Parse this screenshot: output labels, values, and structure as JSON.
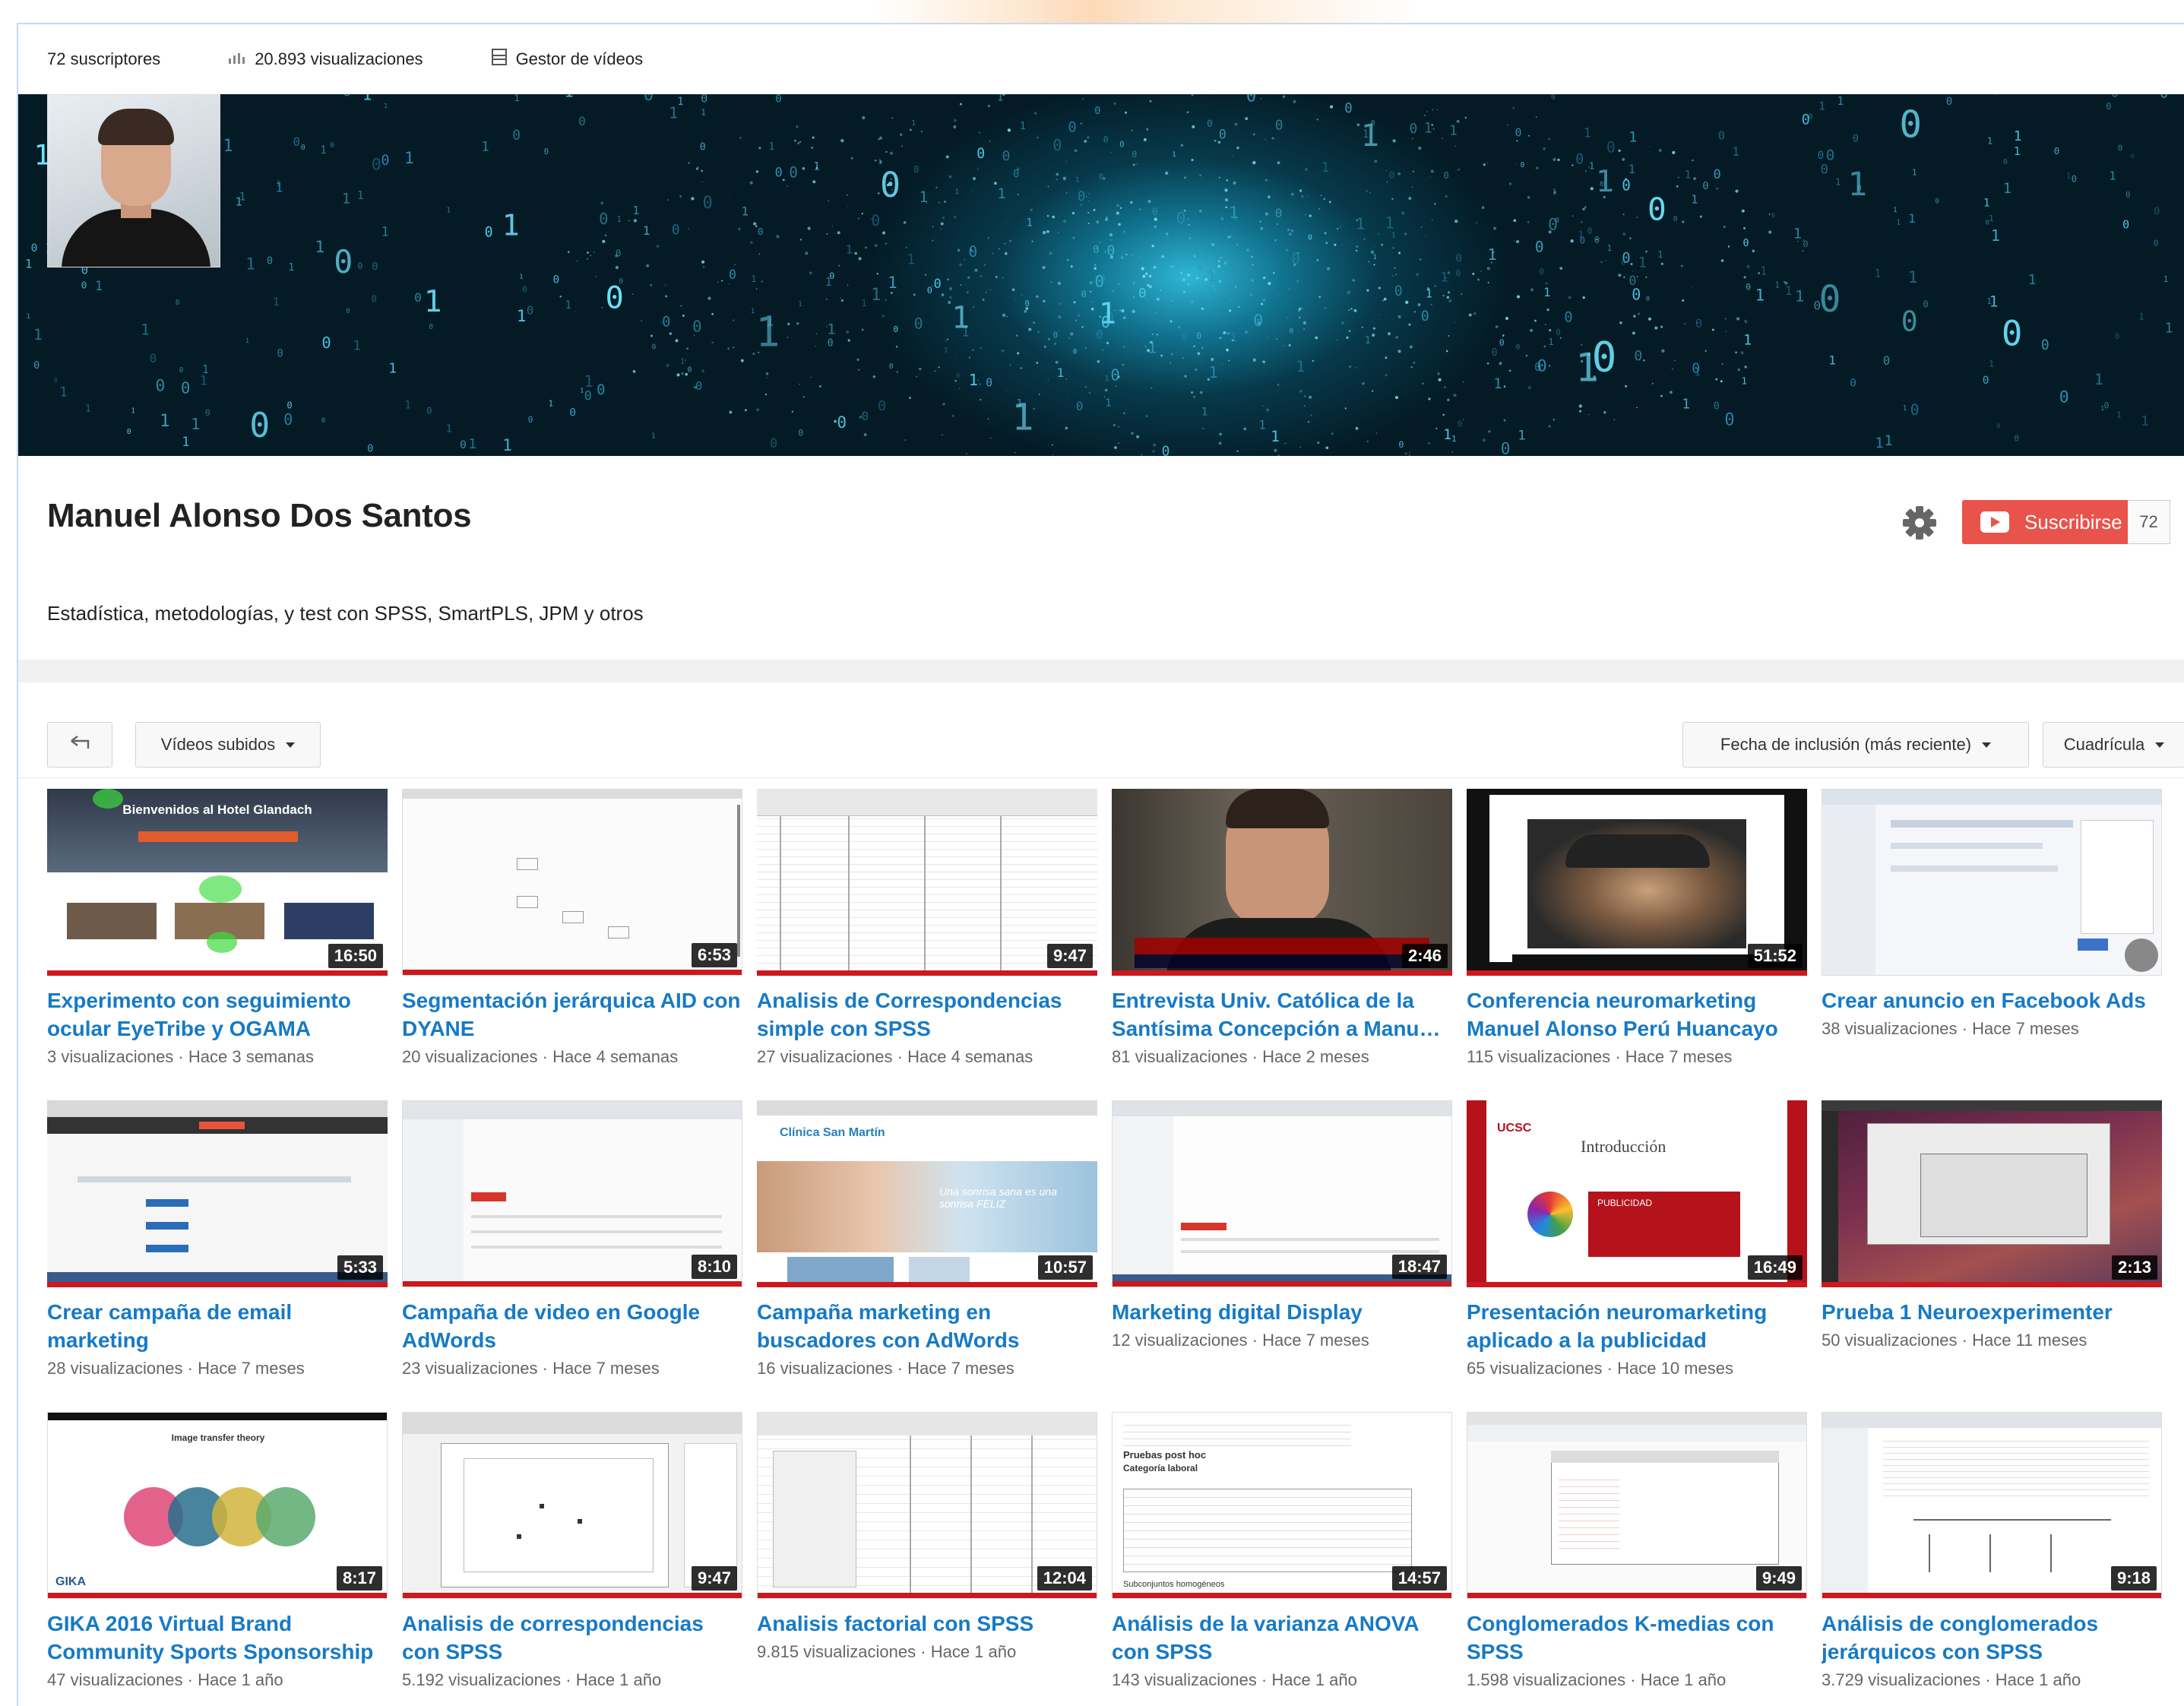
{
  "stats": {
    "subscribers": "72 suscriptores",
    "views": "20.893 visualizaciones",
    "video_manager": "Gestor de vídeos"
  },
  "channel": {
    "name": "Manuel Alonso Dos Santos",
    "description": "Estadística, metodologías, y test con SPSS, SmartPLS, JPM y otros",
    "subscribe_label": "Suscribirse",
    "subscriber_count": "72"
  },
  "toolbar": {
    "uploads_label": "Vídeos subidos",
    "sort_label": "Fecha de inclusión (más reciente)",
    "view_label": "Cuadrícula"
  },
  "colors": {
    "link": "#167ac6",
    "subscribe": "#e8534b",
    "progress": "#cc181e"
  },
  "videos": [
    {
      "title": "Experimento con seguimiento ocular EyeTribe y OGAMA",
      "duration": "16:50",
      "views": "3 visualizaciones",
      "age": "Hace 3 semanas"
    },
    {
      "title": "Segmentación jerárquica AID con DYANE",
      "duration": "6:53",
      "views": "20 visualizaciones",
      "age": "Hace 4 semanas"
    },
    {
      "title": "Analisis de Correspondencias simple con SPSS",
      "duration": "9:47",
      "views": "27 visualizaciones",
      "age": "Hace 4 semanas"
    },
    {
      "title": "Entrevista Univ. Católica de la Santísima Concepción a Manu…",
      "duration": "2:46",
      "views": "81 visualizaciones",
      "age": "Hace 2 meses"
    },
    {
      "title": "Conferencia neuromarketing Manuel Alonso Perú Huancayo",
      "duration": "51:52",
      "views": "115 visualizaciones",
      "age": "Hace 7 meses"
    },
    {
      "title": "Crear anuncio en Facebook Ads",
      "duration": "",
      "views": "38 visualizaciones",
      "age": "Hace 7 meses"
    },
    {
      "title": "Crear campaña de email marketing",
      "duration": "5:33",
      "views": "28 visualizaciones",
      "age": "Hace 7 meses"
    },
    {
      "title": "Campaña de video en Google AdWords",
      "duration": "8:10",
      "views": "23 visualizaciones",
      "age": "Hace 7 meses"
    },
    {
      "title": "Campaña marketing en buscadores con AdWords",
      "duration": "10:57",
      "views": "16 visualizaciones",
      "age": "Hace 7 meses"
    },
    {
      "title": "Marketing digital Display",
      "duration": "18:47",
      "views": "12 visualizaciones",
      "age": "Hace 7 meses"
    },
    {
      "title": "Presentación neuromarketing aplicado a la publicidad",
      "duration": "16:49",
      "views": "65 visualizaciones",
      "age": "Hace 10 meses"
    },
    {
      "title": "Prueba 1 Neuroexperimenter",
      "duration": "2:13",
      "views": "50 visualizaciones",
      "age": "Hace 11 meses"
    },
    {
      "title": "GIKA 2016 Virtual Brand Community Sports Sponsorship",
      "duration": "8:17",
      "views": "47 visualizaciones",
      "age": "Hace 1 año"
    },
    {
      "title": "Analisis de correspondencias con SPSS",
      "duration": "9:47",
      "views": "5.192 visualizaciones",
      "age": "Hace 1 año"
    },
    {
      "title": "Analisis factorial con SPSS",
      "duration": "12:04",
      "views": "9.815 visualizaciones",
      "age": "Hace 1 año"
    },
    {
      "title": "Análisis de la varianza ANOVA con SPSS",
      "duration": "14:57",
      "views": "143 visualizaciones",
      "age": "Hace 1 año"
    },
    {
      "title": "Conglomerados K-medias con SPSS",
      "duration": "9:49",
      "views": "1.598 visualizaciones",
      "age": "Hace 1 año"
    },
    {
      "title": "Análisis de conglomerados jerárquicos con SPSS",
      "duration": "9:18",
      "views": "3.729 visualizaciones",
      "age": "Hace 1 año"
    }
  ],
  "thumb_text": {
    "hotel": "Bienvenidos al Hotel Glandach",
    "clinic": "Clínica San Martín",
    "clinic_slogan": "Una sonrisa sana es una sonrisa FELIZ",
    "ucsc": "UCSC",
    "intro": "Introducción",
    "publicidad": "PUBLICIDAD",
    "gika": "GIKA",
    "gika_heading": "Image transfer theory",
    "anova_heading": "Pruebas post hoc",
    "anova_sub": "Categoría laboral",
    "anova_foot": "Subconjuntos homogéneos"
  }
}
